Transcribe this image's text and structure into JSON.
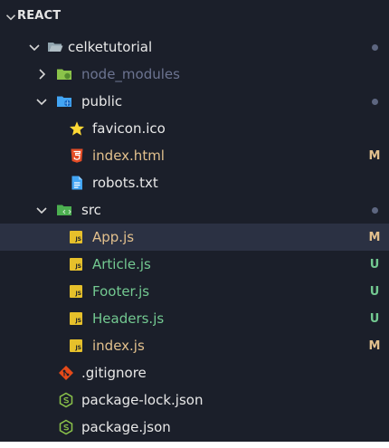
{
  "explorer": {
    "title": "REACT"
  },
  "colors": {
    "panel_bg": "#1b1f2a",
    "selected_bg": "#2b3143",
    "text": "#e8e8e8",
    "dim_text": "#6c7491",
    "modified": "#e2c08d",
    "untracked": "#73c991",
    "dot": "#5d6680"
  },
  "tree": [
    {
      "id": "celketutorial",
      "label": "celketutorial",
      "badge": "",
      "dot": true
    },
    {
      "id": "node_modules",
      "label": "node_modules",
      "badge": "",
      "dot": false
    },
    {
      "id": "public",
      "label": "public",
      "badge": "",
      "dot": true
    },
    {
      "id": "favicon",
      "label": "favicon.ico",
      "badge": ""
    },
    {
      "id": "index-html",
      "label": "index.html",
      "badge": "M"
    },
    {
      "id": "robots",
      "label": "robots.txt",
      "badge": ""
    },
    {
      "id": "src",
      "label": "src",
      "badge": "",
      "dot": true
    },
    {
      "id": "app-js",
      "label": "App.js",
      "badge": "M"
    },
    {
      "id": "article-js",
      "label": "Article.js",
      "badge": "U"
    },
    {
      "id": "footer-js",
      "label": "Footer.js",
      "badge": "U"
    },
    {
      "id": "headers-js",
      "label": "Headers.js",
      "badge": "U"
    },
    {
      "id": "index-js",
      "label": "index.js",
      "badge": "M"
    },
    {
      "id": "gitignore",
      "label": ".gitignore",
      "badge": ""
    },
    {
      "id": "package-lock",
      "label": "package-lock.json",
      "badge": ""
    },
    {
      "id": "package-json",
      "label": "package.json",
      "badge": ""
    }
  ]
}
